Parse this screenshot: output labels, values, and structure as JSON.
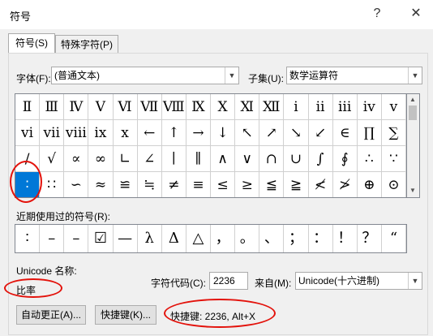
{
  "window": {
    "title": "符号",
    "help_glyph": "?",
    "close_glyph": "✕"
  },
  "tabs": [
    {
      "label": "符号(S)"
    },
    {
      "label": "特殊字符(P)"
    }
  ],
  "font": {
    "label": "字体(F):",
    "value": "(普通文本)"
  },
  "subset": {
    "label": "子集(U):",
    "value": "数学运算符"
  },
  "symbols": [
    [
      "Ⅱ",
      "Ⅲ",
      "Ⅳ",
      "Ⅴ",
      "Ⅵ",
      "Ⅶ",
      "Ⅷ",
      "Ⅸ",
      "Ⅹ",
      "Ⅺ",
      "Ⅻ",
      "ⅰ",
      "ⅱ",
      "ⅲ",
      "ⅳ",
      "ⅴ"
    ],
    [
      "ⅵ",
      "ⅶ",
      "ⅷ",
      "ⅸ",
      "ⅹ",
      "←",
      "↑",
      "→",
      "↓",
      "↖",
      "↗",
      "↘",
      "↙",
      "∈",
      "∏",
      "∑"
    ],
    [
      "∕",
      "√",
      "∝",
      "∞",
      "∟",
      "∠",
      "∣",
      "∥",
      "∧",
      "∨",
      "∩",
      "∪",
      "∫",
      "∮",
      "∴",
      "∵"
    ],
    [
      "∶",
      "∷",
      "∽",
      "≈",
      "≌",
      "≒",
      "≠",
      "≡",
      "≤",
      "≥",
      "≦",
      "≧",
      "≮",
      "≯",
      "⊕",
      "⊙"
    ]
  ],
  "selected": {
    "row": 3,
    "col": 0
  },
  "recent": {
    "label": "近期使用过的符号(R):",
    "items": [
      "∶",
      "–",
      "–",
      "☑",
      "—",
      "λ",
      "Δ",
      "△",
      "，",
      "。",
      "、",
      "；",
      "：",
      "！",
      "？",
      "“"
    ]
  },
  "unicode": {
    "label": "Unicode 名称:",
    "name": "比率"
  },
  "charcode": {
    "label": "字符代码(C):",
    "value": "2236"
  },
  "from": {
    "label": "来自(M):",
    "value": "Unicode(十六进制)"
  },
  "buttons": {
    "autocorrect": "自动更正(A)...",
    "shortcut": "快捷键(K)..."
  },
  "shortcut_text": "快捷键: 2236, Alt+X"
}
